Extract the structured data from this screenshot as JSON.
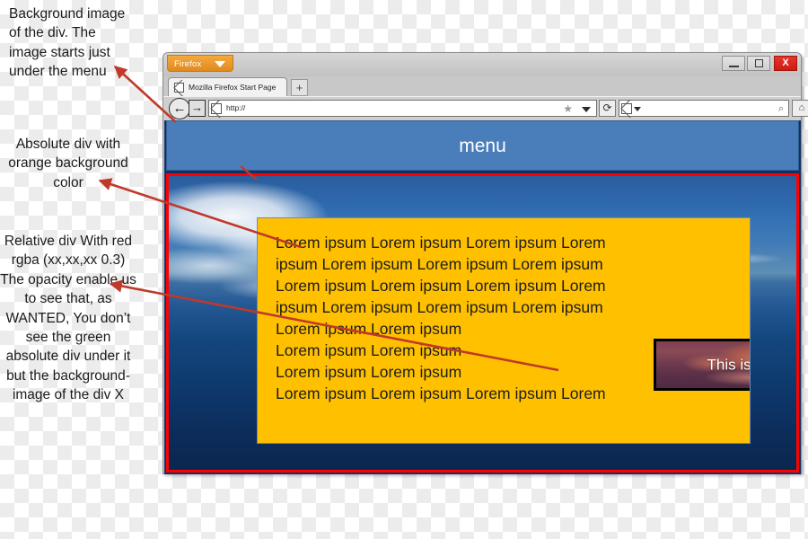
{
  "annotations": {
    "background_note": "Background image of the div. The image starts just under the menu",
    "absolute_note": "Absolute div with orange background color",
    "relative_note": "Relative div With red rgba (xx,xx,xx 0.3) The opacity enable us to see that, as WANTED, You don’t see the green absolute div under it but the background-image of the div X"
  },
  "browser": {
    "app_button_label": "Firefox",
    "tab_title": "Mozilla Firefox Start Page",
    "new_tab_label": "+",
    "back_glyph": "←",
    "forward_glyph": "→",
    "url_value": "http://",
    "url_placeholder": "http://",
    "star_glyph": "★",
    "reload_glyph": "⟳",
    "search_value": "",
    "search_placeholder": "",
    "search_glyph": "⌕",
    "home_glyph": "⌂",
    "bookmark_glyph": "★",
    "window_controls": {
      "minimize": "",
      "maximize": "",
      "close": "X"
    }
  },
  "page": {
    "menu_label": "menu",
    "orange_lines": [
      "Lorem ipsum Lorem ipsum Lorem ipsum Lorem",
      "ipsum Lorem ipsum Lorem ipsum Lorem ipsum",
      "Lorem ipsum Lorem ipsum Lorem ipsum Lorem",
      "ipsum Lorem ipsum Lorem ipsum Lorem ipsum",
      "Lorem ipsum Lorem ipsum",
      "Lorem ipsum Lorem ipsum",
      "Lorem ipsum Lorem ipsum",
      "Lorem ipsum Lorem ipsum Lorem ipsum Lorem"
    ],
    "image_caption": "This is cool"
  },
  "colors": {
    "menu_blue": "#4a7ebb",
    "orange": "#ffc000",
    "red_border": "#ff0000",
    "arrow_red": "#c0392b",
    "firefox_orange": "#e08a1e",
    "close_red": "#cf1c13"
  }
}
